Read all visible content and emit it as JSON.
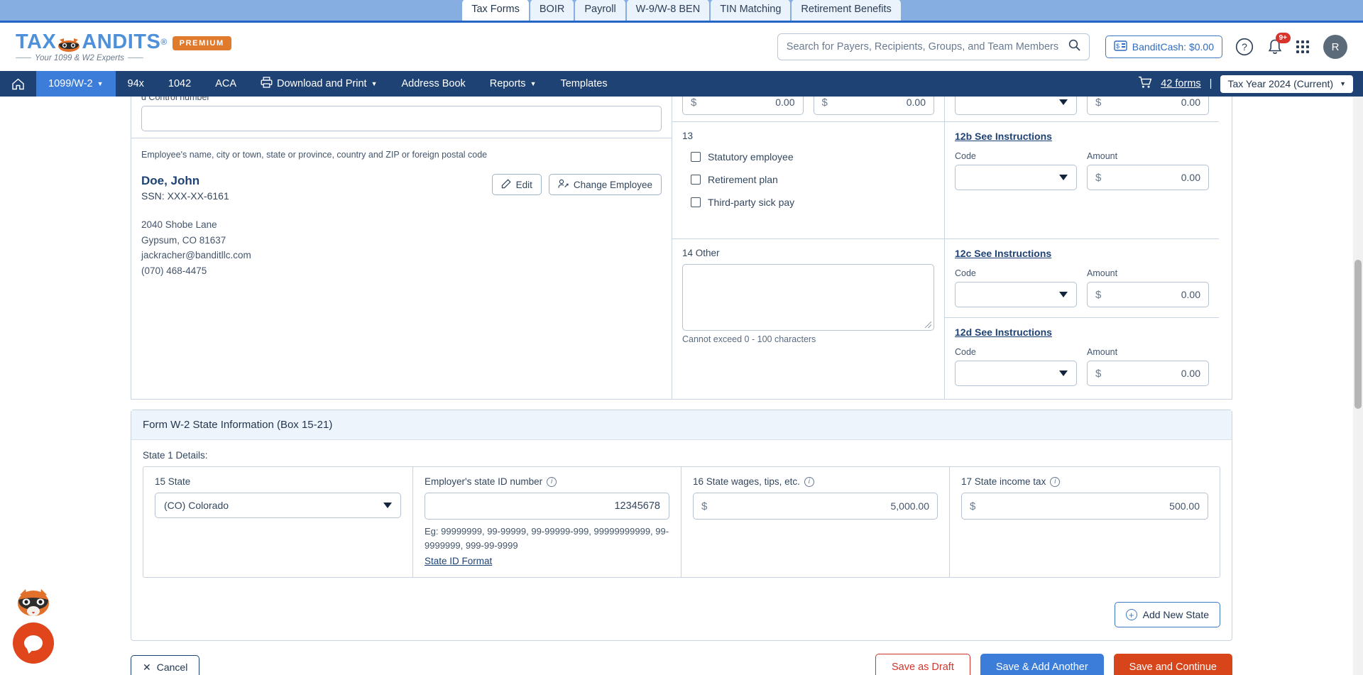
{
  "top_tabs": [
    {
      "label": "Tax Forms",
      "active": true
    },
    {
      "label": "BOIR",
      "active": false
    },
    {
      "label": "Payroll",
      "active": false
    },
    {
      "label": "W-9/W-8 BEN",
      "active": false
    },
    {
      "label": "TIN Matching",
      "active": false
    },
    {
      "label": "Retirement Benefits",
      "active": false
    }
  ],
  "brand": {
    "name_part1": "TAX",
    "name_part2": "ANDITS",
    "registered": "®",
    "tagline": "Your 1099 & W2 Experts",
    "premium_badge": "PREMIUM"
  },
  "header": {
    "search_placeholder": "Search for Payers, Recipients, Groups, and Team Members",
    "search_value": "",
    "banditcash_label": "BanditCash: $0.00",
    "help_glyph": "?",
    "notification_badge": "9+",
    "avatar_initial": "R"
  },
  "nav": {
    "items": [
      {
        "label": "1099/W-2",
        "active": true,
        "caret": true,
        "icon": null
      },
      {
        "label": "94x",
        "active": false,
        "caret": false,
        "icon": null
      },
      {
        "label": "1042",
        "active": false,
        "caret": false,
        "icon": null
      },
      {
        "label": "ACA",
        "active": false,
        "caret": false,
        "icon": null
      },
      {
        "label": "Download and Print",
        "active": false,
        "caret": true,
        "icon": "printer-icon"
      },
      {
        "label": "Address Book",
        "active": false,
        "caret": false,
        "icon": null
      },
      {
        "label": "Reports",
        "active": false,
        "caret": true,
        "icon": null
      },
      {
        "label": "Templates",
        "active": false,
        "caret": false,
        "icon": null
      }
    ],
    "cart_label": "42 forms",
    "divider": "|",
    "tax_year": "Tax Year 2024 (Current)"
  },
  "form": {
    "control_number_label": "d   Control number",
    "control_number_value": "",
    "employee_header": "Employee's name, city or town, state or province, country and ZIP or foreign postal code",
    "employee_name": "Doe, John",
    "employee_ssn": "SSN: XXX-XX-6161",
    "employee_address1": "2040 Shobe Lane",
    "employee_address2": "Gypsum, CO 81637",
    "employee_email": "jackracher@banditllc.com",
    "employee_phone": "(070) 468-4475",
    "edit_button": "Edit",
    "change_employee_button": "Change Employee",
    "top_money_1": "0.00",
    "top_money_2": "0.00",
    "top_money_3": "0.00",
    "dollar_sign": "$",
    "box13": {
      "number": "13",
      "checkboxes": [
        {
          "label": "Statutory employee",
          "checked": false
        },
        {
          "label": "Retirement plan",
          "checked": false
        },
        {
          "label": "Third-party sick pay",
          "checked": false
        }
      ]
    },
    "box14": {
      "label": "14   Other",
      "value": "",
      "hint": "Cannot exceed 0 - 100 characters"
    },
    "box12_rows": [
      {
        "link": "12b See Instructions",
        "code_label": "Code",
        "code_value": "",
        "amount_label": "Amount",
        "amount_value": "0.00"
      },
      {
        "link": "12c See Instructions",
        "code_label": "Code",
        "code_value": "",
        "amount_label": "Amount",
        "amount_value": "0.00"
      },
      {
        "link": "12d See Instructions",
        "code_label": "Code",
        "code_value": "",
        "amount_label": "Amount",
        "amount_value": "0.00"
      }
    ]
  },
  "state_section": {
    "title": "Form W-2 State Information (Box 15-21)",
    "subtitle": "State 1 Details:",
    "state_label": "15   State",
    "state_value": "(CO) Colorado",
    "employer_state_id_label": "Employer's state ID number",
    "employer_state_id_value": "12345678",
    "eg_text": "Eg: 99999999, 99-99999, 99-99999-999, 99999999999, 99-9999999, 999-99-9999",
    "state_id_format_link": "State ID Format",
    "state_wages_label": "16   State wages, tips, etc.",
    "state_wages_value": "5,000.00",
    "state_income_tax_label": "17   State income tax",
    "state_income_tax_value": "500.00",
    "add_new_state_button": "Add New State",
    "dollar_sign": "$"
  },
  "footer": {
    "cancel": "Cancel",
    "save_as_draft": "Save as Draft",
    "save_add_another": "Save & Add Another",
    "save_and_continue": "Save and Continue"
  },
  "colors": {
    "nav_blue": "#1e4274",
    "accent_blue": "#3b7dd8",
    "orange": "#d9451b",
    "premium_orange": "#e07a2c",
    "red": "#d2352c",
    "tabstrip_blue": "#86aee0"
  }
}
